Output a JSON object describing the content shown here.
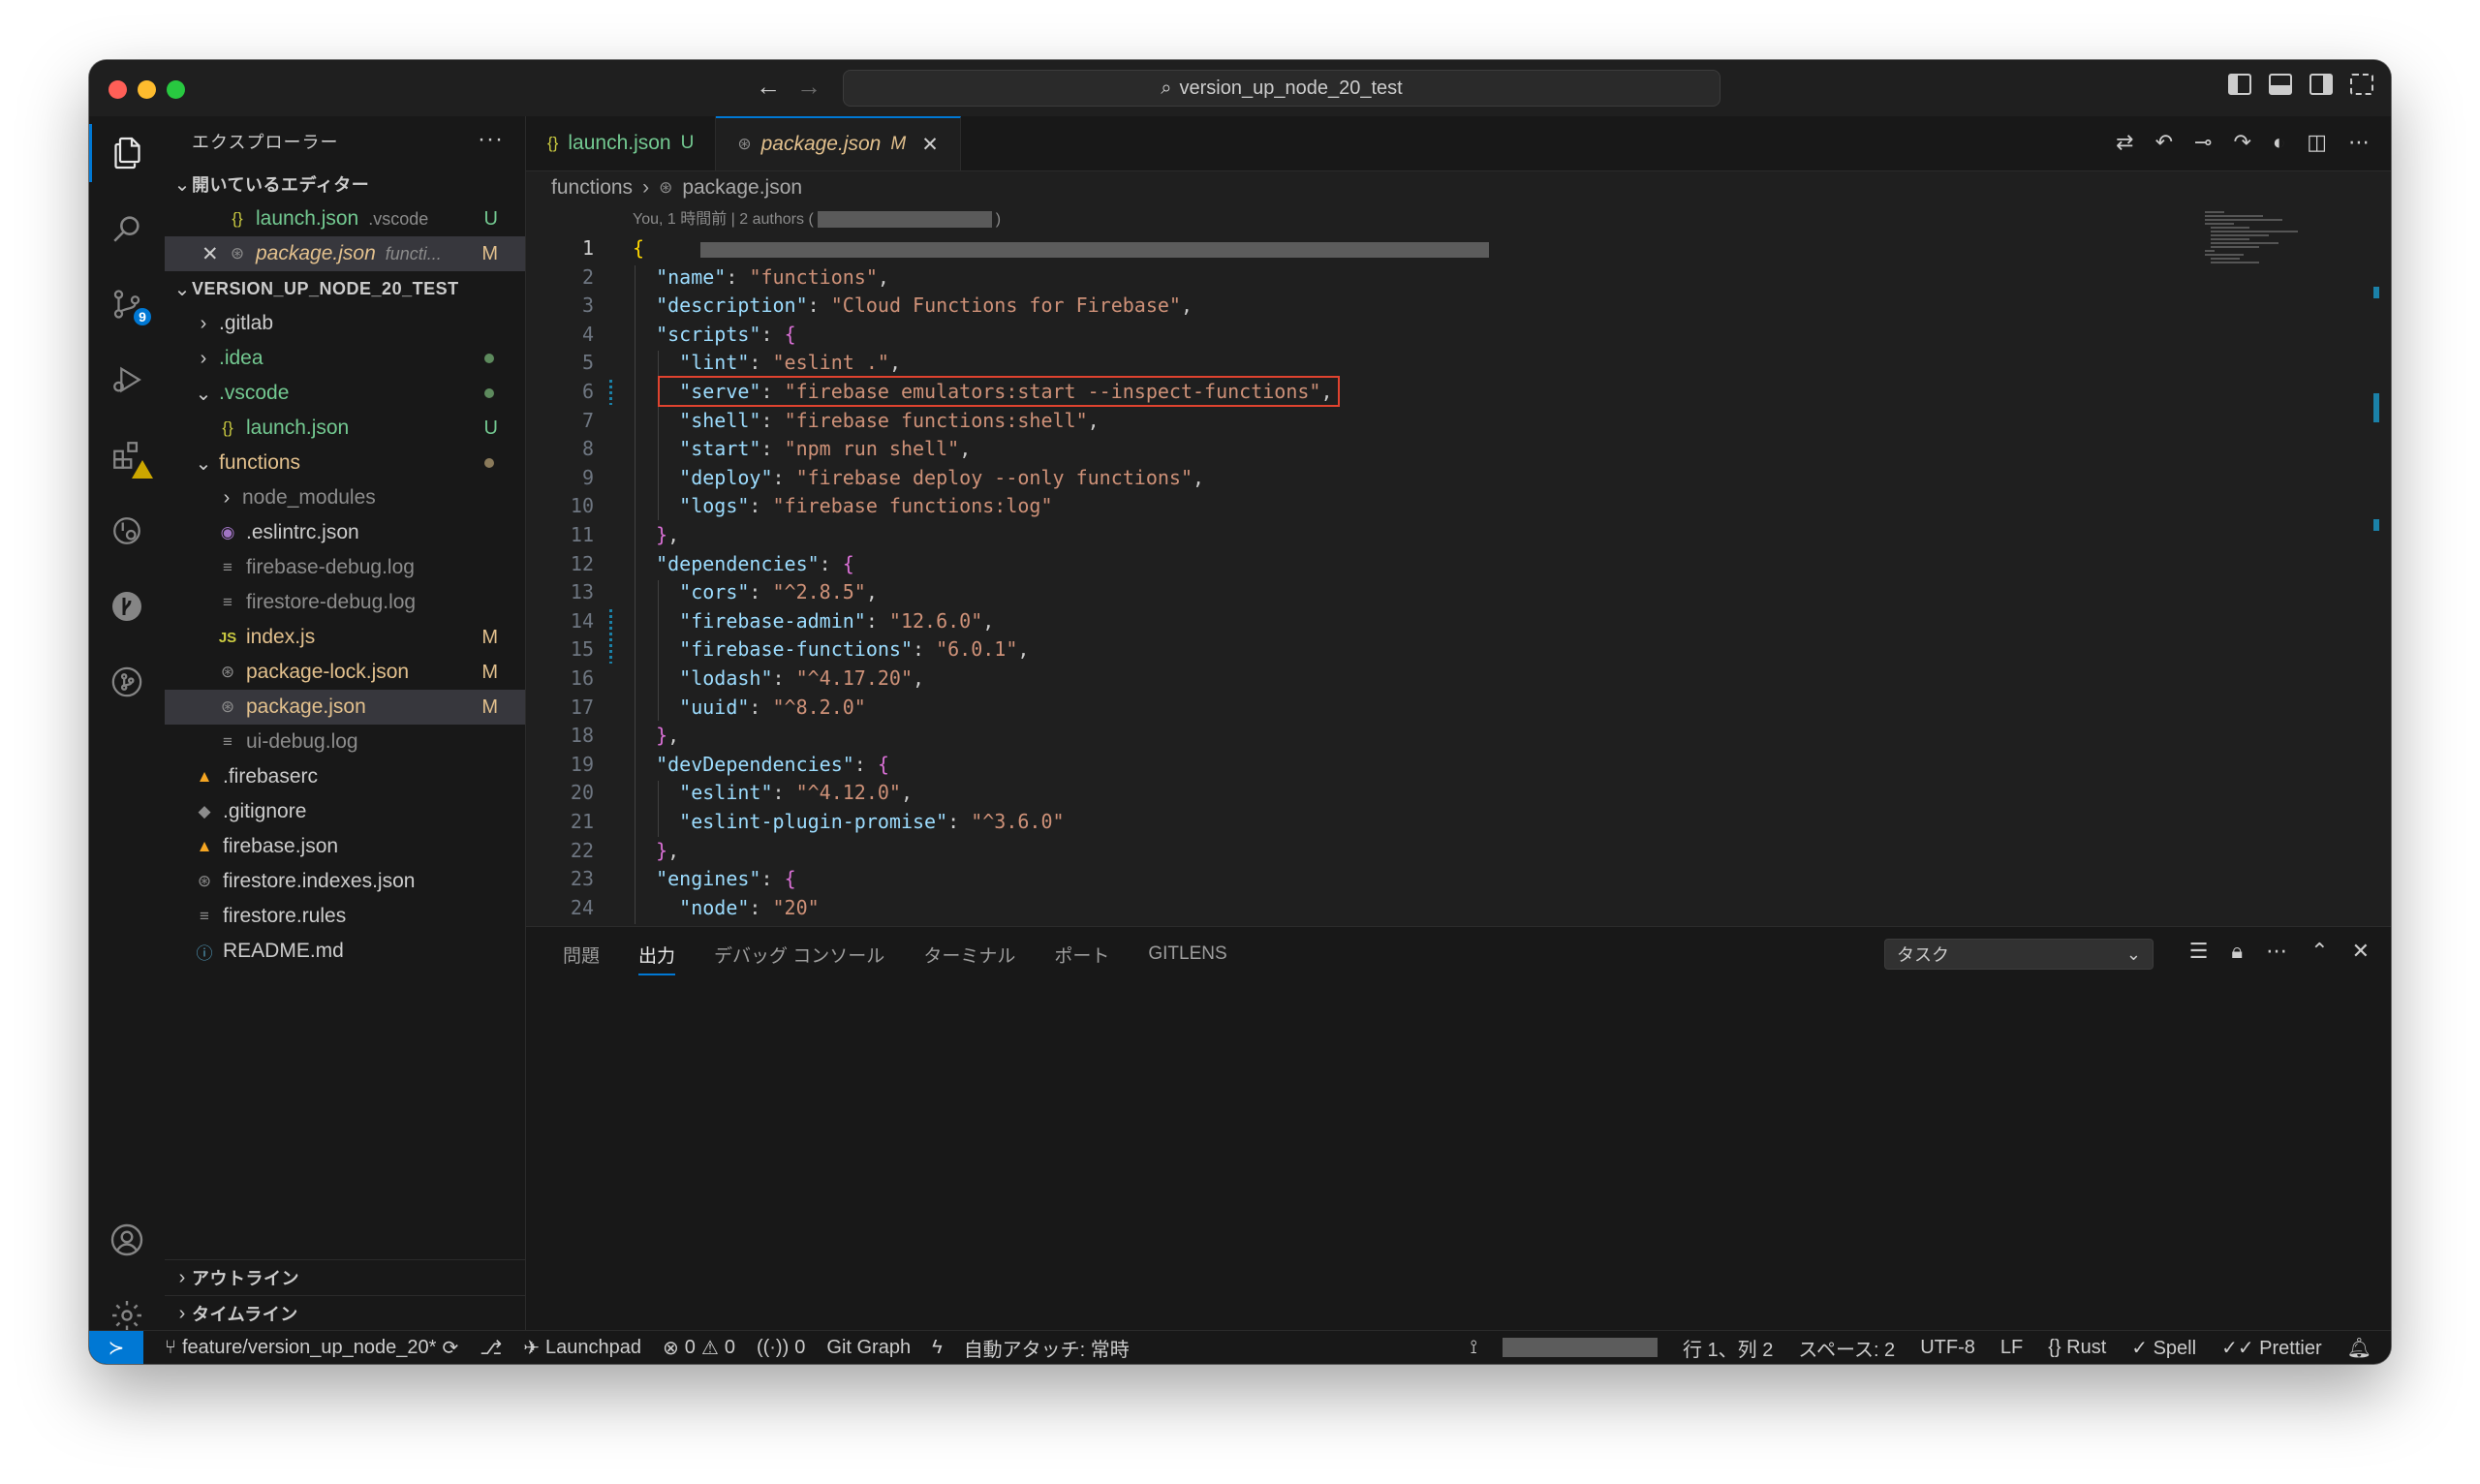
{
  "window": {
    "search": "version_up_node_20_test"
  },
  "sidebar": {
    "title": "エクスプローラー",
    "more": "···",
    "open_editors": {
      "label": "開いているエディター",
      "items": [
        {
          "name": "launch.json",
          "desc": ".vscode",
          "status": "U"
        },
        {
          "name": "package.json",
          "desc": "functi...",
          "status": "M"
        }
      ]
    },
    "project": {
      "label": "VERSION_UP_NODE_20_TEST",
      "tree": [
        {
          "name": ".gitlab",
          "status": ""
        },
        {
          "name": ".idea",
          "status": ""
        },
        {
          "name": ".vscode",
          "status": ""
        },
        {
          "name": "launch.json",
          "status": "U"
        },
        {
          "name": "functions",
          "status": ""
        },
        {
          "name": "node_modules",
          "status": ""
        },
        {
          "name": ".eslintrc.json",
          "status": ""
        },
        {
          "name": "firebase-debug.log",
          "status": ""
        },
        {
          "name": "firestore-debug.log",
          "status": ""
        },
        {
          "name": "index.js",
          "status": "M"
        },
        {
          "name": "package-lock.json",
          "status": "M"
        },
        {
          "name": "package.json",
          "status": "M"
        },
        {
          "name": "ui-debug.log",
          "status": ""
        },
        {
          "name": ".firebaserc",
          "status": ""
        },
        {
          "name": ".gitignore",
          "status": ""
        },
        {
          "name": "firebase.json",
          "status": ""
        },
        {
          "name": "firestore.indexes.json",
          "status": ""
        },
        {
          "name": "firestore.rules",
          "status": ""
        },
        {
          "name": "README.md",
          "status": ""
        }
      ]
    },
    "outline": "アウトライン",
    "timeline": "タイムライン"
  },
  "activity": {
    "scm_badge": "9"
  },
  "editor": {
    "tabs": [
      {
        "name": "launch.json",
        "flag": "U"
      },
      {
        "name": "package.json",
        "flag": "M"
      }
    ],
    "breadcrumb": [
      "functions",
      "package.json"
    ],
    "blame": {
      "prefix": "You, 1 時間前 | 2 authors (",
      "suffix": ")"
    },
    "lines": [
      "1",
      "2",
      "3",
      "4",
      "5",
      "6",
      "7",
      "8",
      "9",
      "10",
      "11",
      "12",
      "13",
      "14",
      "15",
      "16",
      "17",
      "18",
      "19",
      "20",
      "21",
      "22",
      "23",
      "24"
    ],
    "code": {
      "l1": "{",
      "name_k": "\"name\"",
      "name_v": "\"functions\"",
      "desc_k": "\"description\"",
      "desc_v": "\"Cloud Functions for Firebase\"",
      "scripts_k": "\"scripts\"",
      "lint_k": "\"lint\"",
      "lint_v": "\"eslint .\"",
      "serve_k": "\"serve\"",
      "serve_v": "\"firebase emulators:start --inspect-functions\"",
      "shell_k": "\"shell\"",
      "shell_v": "\"firebase functions:shell\"",
      "start_k": "\"start\"",
      "start_v": "\"npm run shell\"",
      "deploy_k": "\"deploy\"",
      "deploy_v": "\"firebase deploy --only functions\"",
      "logs_k": "\"logs\"",
      "logs_v": "\"firebase functions:log\"",
      "deps_k": "\"dependencies\"",
      "cors_k": "\"cors\"",
      "cors_v": "\"^2.8.5\"",
      "fadmin_k": "\"firebase-admin\"",
      "fadmin_v": "\"12.6.0\"",
      "ffunc_k": "\"firebase-functions\"",
      "ffunc_v": "\"6.0.1\"",
      "lodash_k": "\"lodash\"",
      "lodash_v": "\"^4.17.20\"",
      "uuid_k": "\"uuid\"",
      "uuid_v": "\"^8.2.0\"",
      "devdeps_k": "\"devDependencies\"",
      "eslint_k": "\"eslint\"",
      "eslint_v": "\"^4.12.0\"",
      "epp_k": "\"eslint-plugin-promise\"",
      "epp_v": "\"^3.6.0\"",
      "engines_k": "\"engines\"",
      "node_k": "\"node\"",
      "node_v": "\"20\""
    }
  },
  "panel": {
    "tabs": [
      "問題",
      "出力",
      "デバッグ コンソール",
      "ターミナル",
      "ポート",
      "GITLENS"
    ],
    "active_tab": "出力",
    "select_value": "タスク"
  },
  "statusbar": {
    "branch": "feature/version_up_node_20*",
    "launchpad": "Launchpad",
    "errors": "0",
    "warnings": "0",
    "ports": "0",
    "git_graph": "Git Graph",
    "auto_attach": "自動アタッチ: 常時",
    "position": "行 1、列 2",
    "spaces": "スペース: 2",
    "encoding": "UTF-8",
    "eol": "LF",
    "language": "Rust",
    "spell": "Spell",
    "prettier": "Prettier"
  },
  "colors": {
    "accent": "#0078d4",
    "highlight_box": "#e0432f",
    "modified": "#e2c08d",
    "untracked": "#73c991"
  }
}
